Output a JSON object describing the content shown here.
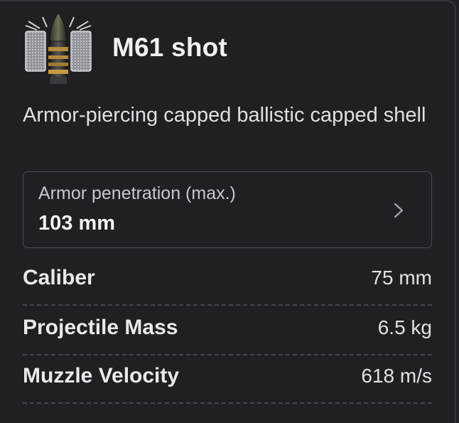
{
  "shell": {
    "icon": "shell-icon",
    "name": "M61 shot",
    "description": "Armor-piercing capped ballistic capped shell"
  },
  "penetration": {
    "label": "Armor penetration (max.)",
    "value": "103 mm",
    "chevron_icon": "chevron-right-icon"
  },
  "stats": [
    {
      "label": "Caliber",
      "value": "75 mm"
    },
    {
      "label": "Projectile Mass",
      "value": "6.5 kg"
    },
    {
      "label": "Muzzle Velocity",
      "value": "618 m/s"
    }
  ]
}
